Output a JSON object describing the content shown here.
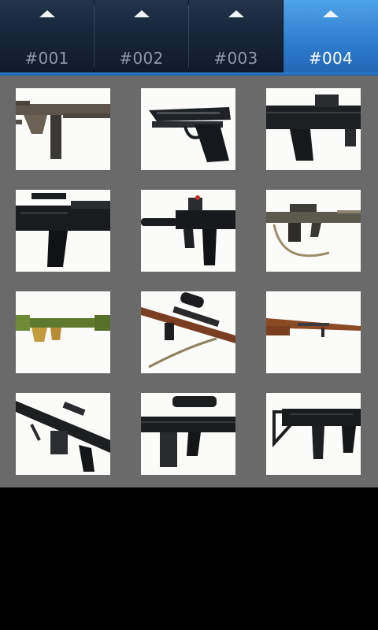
{
  "tabs": [
    {
      "label": "#001",
      "active": false
    },
    {
      "label": "#002",
      "active": false
    },
    {
      "label": "#003",
      "active": false
    },
    {
      "label": "#004",
      "active": true
    }
  ],
  "colors": {
    "tab_inactive_text": "#8d98a6",
    "tab_active_text": "#ffffff",
    "tab_active_bg": "#3b8fdc",
    "grid_bg": "#6a6a6a",
    "screen_bg": "#000000"
  },
  "gallery": {
    "items": [
      {
        "icon": "bullpup-rifle-icon"
      },
      {
        "icon": "pistol-icon"
      },
      {
        "icon": "pdw-icon"
      },
      {
        "icon": "assault-rifle-icon"
      },
      {
        "icon": "smg-with-suppressor-icon"
      },
      {
        "icon": "bullpup-with-sling-icon"
      },
      {
        "icon": "rocket-launcher-icon"
      },
      {
        "icon": "scoped-rifle-icon"
      },
      {
        "icon": "bolt-action-rifle-icon"
      },
      {
        "icon": "machine-gun-icon"
      },
      {
        "icon": "scoped-battle-rifle-icon"
      },
      {
        "icon": "machine-pistol-icon"
      }
    ]
  }
}
